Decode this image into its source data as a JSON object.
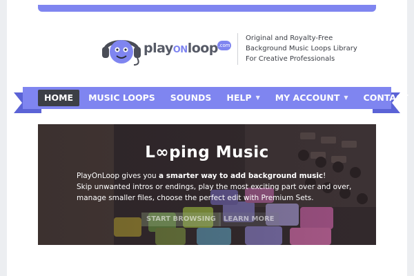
{
  "header": {
    "logo": {
      "word_play": "play",
      "word_on": "ON",
      "word_loop": "loop",
      "badge": ".com"
    },
    "tagline": [
      "Original and Royalty-Free",
      "Background Music Loops Library",
      "For Creative Professionals"
    ]
  },
  "nav": {
    "items": [
      {
        "label": "HOME",
        "active": true,
        "dropdown": false
      },
      {
        "label": "MUSIC LOOPS",
        "active": false,
        "dropdown": false
      },
      {
        "label": "SOUNDS",
        "active": false,
        "dropdown": false
      },
      {
        "label": "HELP",
        "active": false,
        "dropdown": true
      },
      {
        "label": "MY ACCOUNT",
        "active": false,
        "dropdown": true
      },
      {
        "label": "CONTACT",
        "active": false,
        "dropdown": false
      }
    ]
  },
  "hero": {
    "title": "L∞ping Music",
    "line1_pre": "PlayOnLoop gives you ",
    "line1_bold": "a smarter way to add background music",
    "line1_post": "!",
    "line2": "Skip unwanted intros or endings, play the most exciting part over and over,",
    "line3": "manage smaller files, choose the perfect edit with Premium Sets.",
    "primary_button": "START BROWSING",
    "secondary_button": "LEARN MORE"
  },
  "colors": {
    "accent": "#7f85f0",
    "accent_dark": "#5b63d6",
    "nav_active": "#3c3f46",
    "text": "#3a3d44"
  }
}
